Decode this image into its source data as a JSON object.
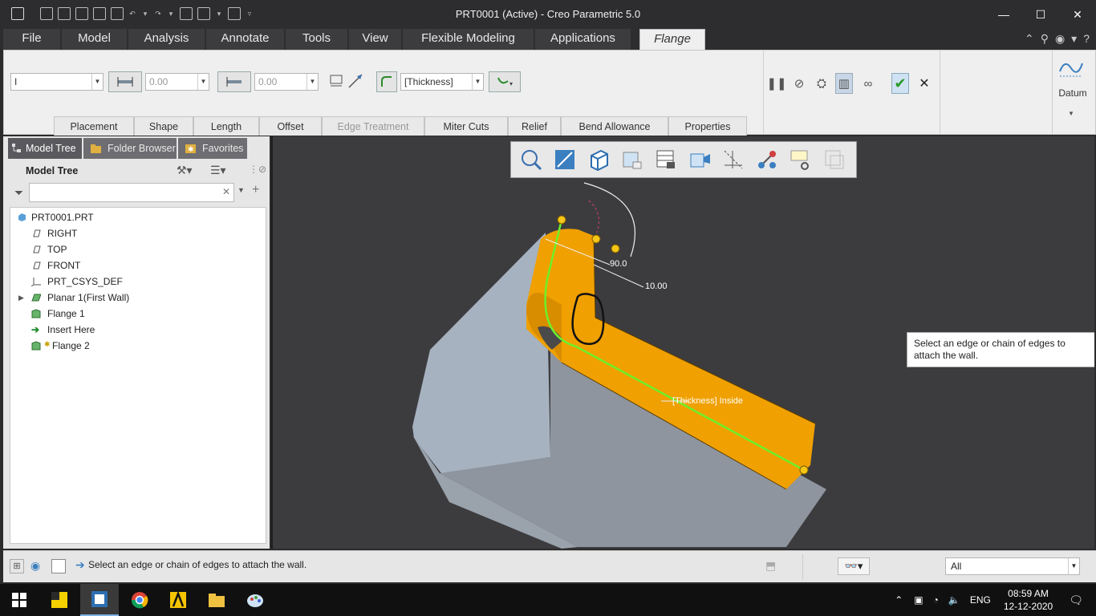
{
  "window": {
    "title": "PRT0001 (Active) - Creo Parametric 5.0",
    "minimize": "—",
    "maximize": "☐",
    "close": "✕"
  },
  "menu": {
    "tabs": [
      "File",
      "Model",
      "Analysis",
      "Annotate",
      "Tools",
      "View",
      "Flexible Modeling",
      "Applications",
      "Flange"
    ],
    "active": "Flange"
  },
  "ribbon": {
    "shape_select": "I",
    "length_value_1": "0.00",
    "length_value_2": "0.00",
    "thickness_select": "[Thickness]",
    "datum_label": "Datum",
    "subtabs": [
      "Placement",
      "Shape",
      "Length",
      "Offset",
      "Edge Treatment",
      "Miter Cuts",
      "Relief",
      "Bend Allowance",
      "Properties"
    ],
    "disabled_subtab": "Edge Treatment"
  },
  "panel": {
    "tabs": [
      "Model Tree",
      "Folder Browser",
      "Favorites"
    ],
    "header": "Model Tree",
    "search_placeholder": "",
    "items": [
      {
        "label": "PRT0001.PRT",
        "icon": "part-icon"
      },
      {
        "label": "RIGHT",
        "icon": "datum-plane-icon"
      },
      {
        "label": "TOP",
        "icon": "datum-plane-icon"
      },
      {
        "label": "FRONT",
        "icon": "datum-plane-icon"
      },
      {
        "label": "PRT_CSYS_DEF",
        "icon": "csys-icon"
      },
      {
        "label": "Planar 1(First Wall)",
        "icon": "planar-wall-icon"
      },
      {
        "label": "Flange 1",
        "icon": "flange-icon"
      },
      {
        "label": "Insert Here",
        "icon": "insert-arrow-icon"
      },
      {
        "label": "Flange 2",
        "icon": "flange-icon"
      }
    ]
  },
  "graphics": {
    "dim_angle": "90.0",
    "dim_length": "10.00",
    "thickness_label": "[Thickness] Inside",
    "tooltip": "Select an edge or chain of edges to attach the wall."
  },
  "status": {
    "message": "Select an edge or chain of edges to attach the wall.",
    "filter": "All"
  },
  "taskbar": {
    "lang": "ENG",
    "time": "08:59 AM",
    "date": "12-12-2020"
  },
  "colors": {
    "accent_ok": "#3cb043",
    "flange_orange": "#f0a000",
    "selection_green": "#6cf02a"
  }
}
